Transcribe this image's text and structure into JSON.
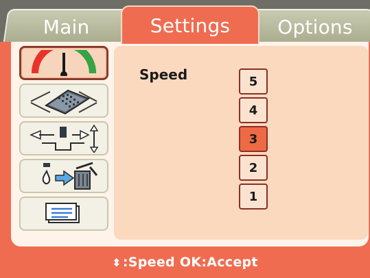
{
  "tabs": [
    {
      "label": "Main",
      "active": false
    },
    {
      "label": "Settings",
      "active": true
    },
    {
      "label": "Options",
      "active": false
    }
  ],
  "menu": {
    "items": [
      {
        "icon": "speedometer-icon",
        "selected": true
      },
      {
        "icon": "keypad-tray-icon",
        "selected": false
      },
      {
        "icon": "punch-transfer-icon",
        "selected": false
      },
      {
        "icon": "drop-to-waste-bin-icon",
        "selected": false
      },
      {
        "icon": "layers-icon",
        "selected": false
      }
    ]
  },
  "panel": {
    "setting_label": "Speed",
    "options": [
      "5",
      "4",
      "3",
      "2",
      "1"
    ],
    "selected_value": "3"
  },
  "status": {
    "arrows": "⬍",
    "text": ":Speed OK:Accept"
  },
  "colors": {
    "accent": "#ef6c50",
    "panel": "#fbd9bf",
    "tab_inactive": "#b8bb9c",
    "selected_border": "#8b3b2b"
  }
}
